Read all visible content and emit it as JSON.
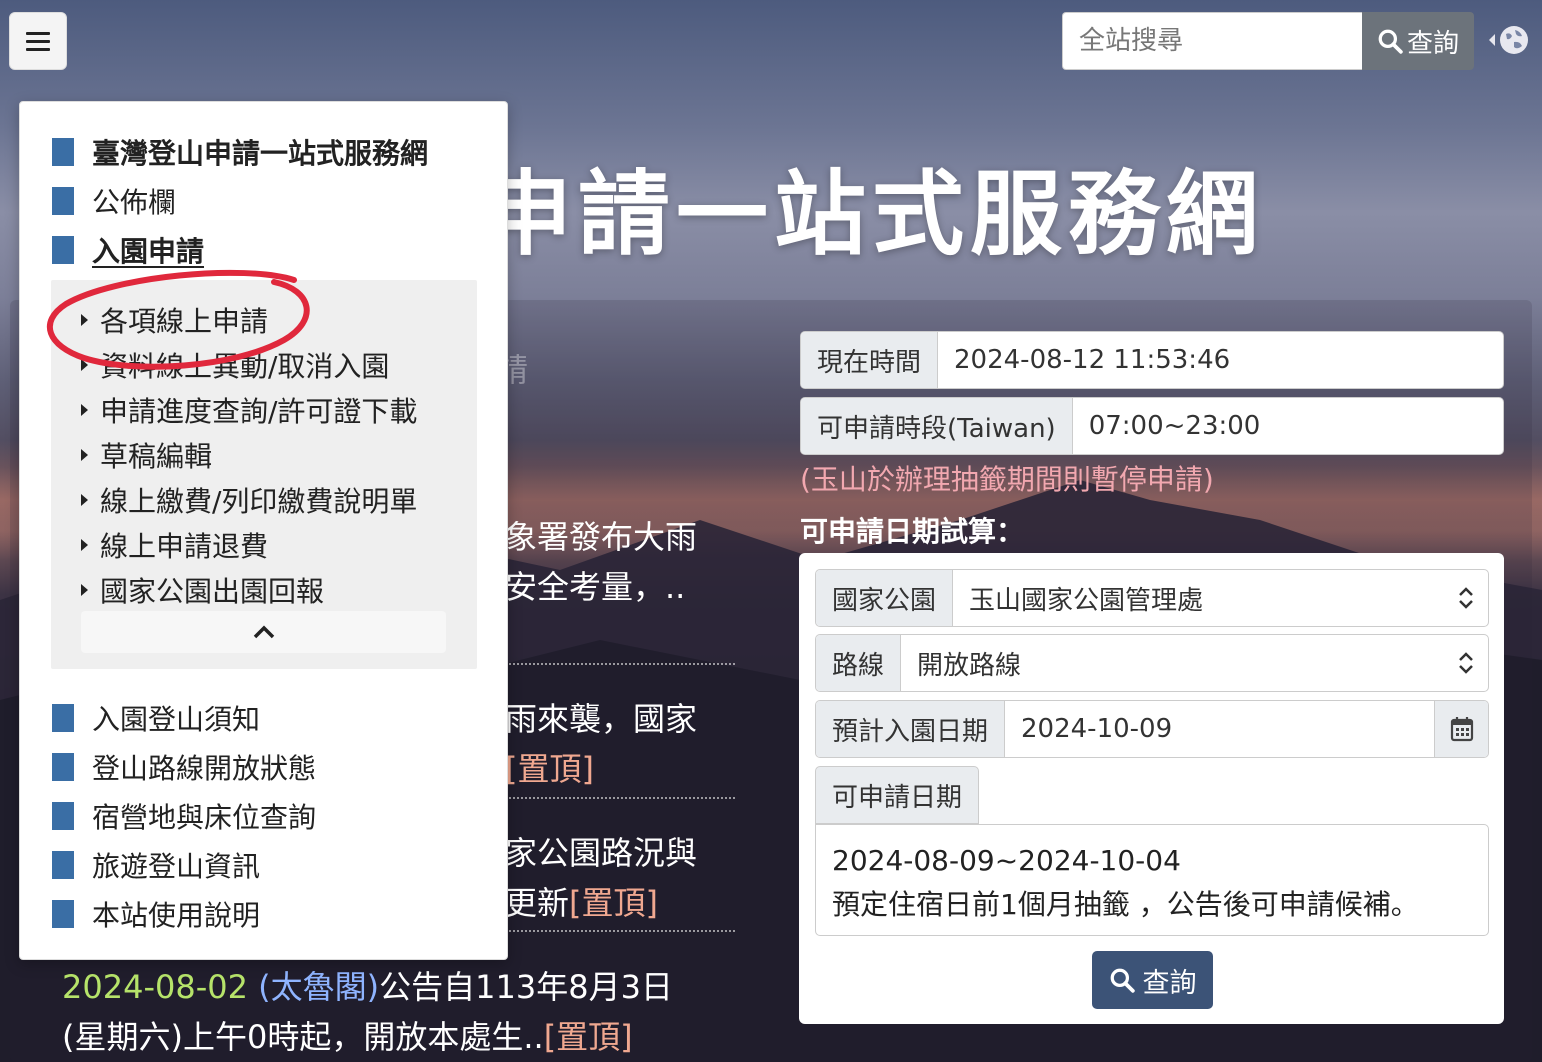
{
  "header": {
    "search_placeholder": "全站搜尋",
    "search_button": "查詢"
  },
  "banner": {
    "title_fragment": "申請一站式服務網"
  },
  "news": {
    "frag1": "請",
    "frag2a": "象署發布大雨",
    "frag2b": "安全考量，..",
    "frag3a": "雨來襲，國家",
    "frag3b_link": "[置頂]",
    "frag4a": "家公園路況與",
    "frag4b_text": "更新",
    "frag4b_link": "[置頂]",
    "item_last": {
      "date": "2024-08-02",
      "source": "(太魯閣)",
      "text1": "公告自113年8月3日",
      "text2": "(星期六)上午0時起，開放本處生..",
      "link": "[置頂]"
    }
  },
  "status": {
    "now_label": "現在時間",
    "now_value": "2024-08-12 11:53:46",
    "period_label": "可申請時段(Taiwan)",
    "period_value": "07:00~23:00",
    "note": "(玉山於辦理抽籤期間則暫停申請)"
  },
  "calc": {
    "title": "可申請日期試算：",
    "park_label": "國家公園",
    "park_value": "玉山國家公園管理處",
    "route_label": "路線",
    "route_value": "開放路線",
    "date_label": "預計入園日期",
    "date_value": "2024-10-09",
    "avail_label": "可申請日期",
    "avail_range": "2024-08-09~2024-10-04",
    "avail_note": "預定住宿日前1個月抽籤 ，公告後可申請候補。",
    "query_button": "查詢"
  },
  "menu": {
    "items_top": [
      "臺灣登山申請一站式服務網",
      "公佈欄",
      "入園申請"
    ],
    "submenu": [
      "各項線上申請",
      "資料線上異動/取消入園",
      "申請進度查詢/許可證下載",
      "草稿編輯",
      "線上繳費/列印繳費說明單",
      "線上申請退費",
      "國家公園出園回報"
    ],
    "items_bottom": [
      "入園登山須知",
      "登山路線開放狀態",
      "宿營地與床位查詢",
      "旅遊登山資訊",
      "本站使用說明"
    ]
  },
  "colors": {
    "menu_marker": "#3a6ea5",
    "query_button": "#3c5377",
    "search_button": "#6c737b",
    "note_pink": "#f2a8b0",
    "news_date": "#b6e36a",
    "news_link": "#f0a890",
    "annotation_red": "#e0283c"
  }
}
